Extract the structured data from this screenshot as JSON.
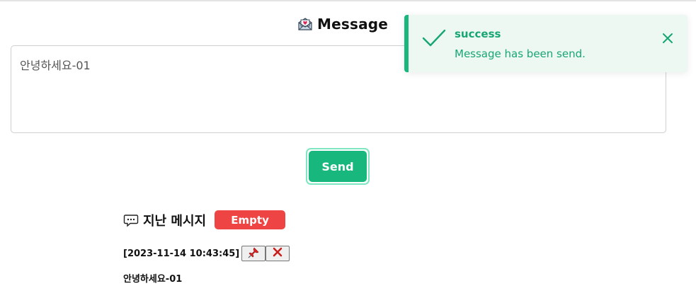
{
  "header": {
    "title": "Message",
    "icon": "envelope-heart-icon"
  },
  "composer": {
    "value": "안녕하세요-01",
    "placeholder": ""
  },
  "actions": {
    "send_label": "Send",
    "send_color": "#17b77e"
  },
  "history": {
    "title": "지난 메시지",
    "icon": "chat-bubble-icon",
    "badge": "Empty",
    "badge_color": "#ef4444",
    "entries": [
      {
        "timestamp": "[2023-11-14 10:43:45]",
        "text": "안녕하세요-01",
        "pin_icon": "pushpin-icon",
        "delete_icon": "cross-mark-icon"
      }
    ]
  },
  "toast": {
    "title": "success",
    "message": "Message has been send.",
    "accent": "#17b77e",
    "background": "#edf8f3"
  }
}
